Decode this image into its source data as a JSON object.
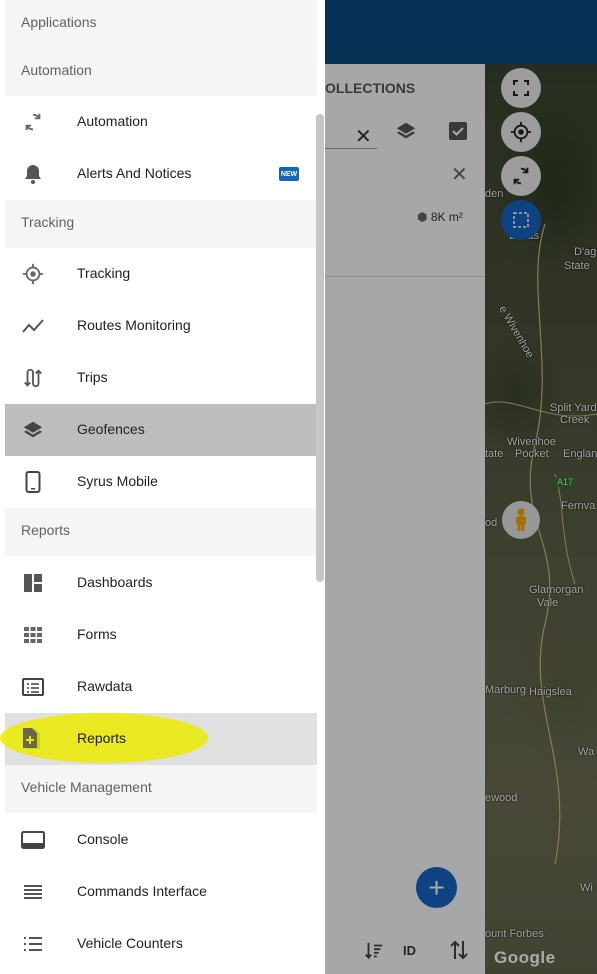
{
  "background": {
    "panel_title": "OLLECTIONS",
    "area_value": "8K m²",
    "sort_label": "ID",
    "fab_label": "+",
    "map_labels": [
      "den",
      "Bellas",
      "D'ag",
      "State",
      "e Wivenhoe",
      "Split Yard",
      "Creek",
      "Wivenhoe",
      "tate",
      "Pocket",
      "Englan",
      "A17",
      "Fernva",
      "od",
      "Glamorgan",
      "Vale",
      "Marburg",
      "Haigslea",
      "Wa",
      "ewood",
      "Wi",
      "ount Forbes"
    ],
    "google_logo": "Google"
  },
  "drawer": {
    "sections": {
      "applications": "Applications",
      "automation": "Automation",
      "tracking": "Tracking",
      "reports": "Reports",
      "vehicle_management": "Vehicle Management"
    },
    "items": {
      "automation": "Automation",
      "alerts": "Alerts And Notices",
      "alerts_badge": "NEW",
      "tracking": "Tracking",
      "routes": "Routes Monitoring",
      "trips": "Trips",
      "geofences": "Geofences",
      "syrus": "Syrus Mobile",
      "dashboards": "Dashboards",
      "forms": "Forms",
      "rawdata": "Rawdata",
      "reports": "Reports",
      "console": "Console",
      "commands": "Commands Interface",
      "counters": "Vehicle Counters"
    },
    "selected_item": "Geofences"
  },
  "colors": {
    "topbar": "#0d4a80",
    "accent": "#1565c0",
    "highlight": "#ebeb00"
  }
}
